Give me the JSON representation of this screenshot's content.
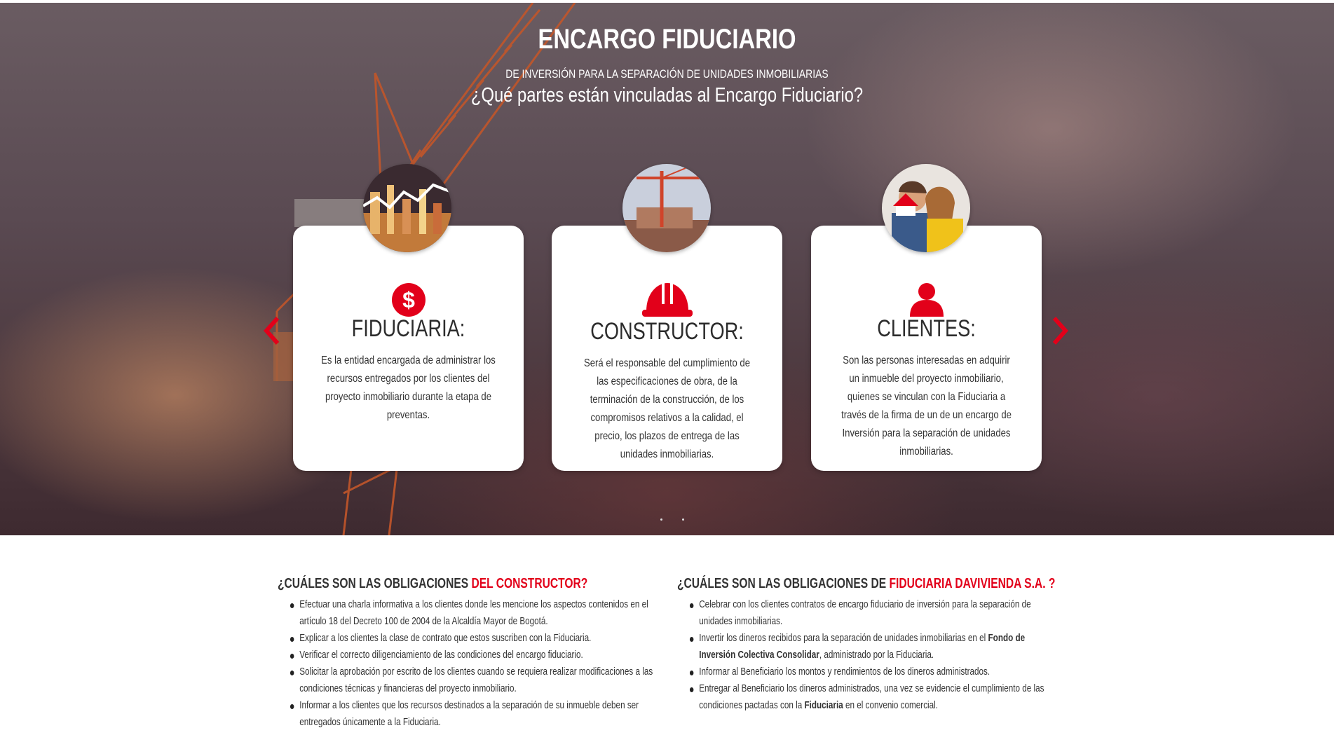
{
  "hero": {
    "title": "ENCARGO FIDUCIARIO",
    "subtitle": "DE INVERSIÓN PARA LA SEPARACIÓN DE UNIDADES INMOBILIARIAS",
    "question": "¿Qué partes están vinculadas al Encargo Fiduciario?"
  },
  "cards": [
    {
      "title": "FIDUCIARIA:",
      "icon": "dollar-circle-icon",
      "photo": "finance-chart-photo",
      "text": "Es la entidad encargada de administrar los recursos entregados por los clientes del proyecto inmobiliario durante la etapa de preventas."
    },
    {
      "title": "CONSTRUCTOR:",
      "icon": "hard-hat-icon",
      "photo": "construction-crane-photo",
      "text": "Será el responsable del cumplimiento de las especificaciones de obra, de la terminación de la construcción, de los compromisos relativos a la calidad, el precio, los plazos de entrega de las unidades inmobiliarias."
    },
    {
      "title": "CLIENTES:",
      "icon": "person-icon",
      "photo": "happy-couple-photo",
      "text": "Son las personas interesadas en adquirir un inmueble del proyecto inmobiliario, quienes se vinculan con la Fiduciaria a través de la firma de un de un encargo de Inversión para la separación de unidades inmobiliarias."
    }
  ],
  "colors": {
    "accent": "#e2001a",
    "text": "#333333",
    "card_bg": "#ffffff"
  },
  "constructor_section": {
    "heading_prefix": "¿CUÁLES SON LAS OBLIGACIONES ",
    "heading_highlight": "DEL CONSTRUCTOR?",
    "items": [
      "Efectuar una charla informativa a los clientes donde les mencione los aspectos contenidos en el artículo 18 del Decreto 100 de 2004 de la Alcaldía Mayor de Bogotá.",
      "Explicar a los clientes la clase de contrato que estos suscriben con la Fiduciaria.",
      "Verificar el correcto diligenciamiento de las condiciones del encargo fiduciario.",
      "Solicitar la aprobación por escrito de los clientes cuando se requiera realizar modificaciones a las condiciones técnicas y financieras del proyecto inmobiliario.",
      "Informar a los clientes que los recursos destinados a la separación de su inmueble deben ser entregados únicamente a la Fiduciaria."
    ]
  },
  "fiduciaria_section": {
    "heading_prefix": "¿CUÁLES SON LAS OBLIGACIONES DE ",
    "heading_highlight": "FIDUCIARIA DAVIVIENDA S.A. ?",
    "item1": "Celebrar con los clientes contratos de encargo fiduciario de inversión para la separación de unidades inmobiliarias.",
    "item2_a": "Invertir los dineros recibidos para la separación de unidades inmobiliarias en el ",
    "item2_bold": "Fondo de Inversión Colectiva Consolidar",
    "item2_b": ", administrado por la Fiduciaria.",
    "item3": "Informar al Beneficiario los montos y rendimientos de los dineros administrados.",
    "item4_a": "Entregar al Beneficiario los dineros administrados, una vez se evidencie el cumplimiento de las condiciones pactadas con la ",
    "item4_bold": "Fiduciaria",
    "item4_b": " en el convenio comercial."
  }
}
